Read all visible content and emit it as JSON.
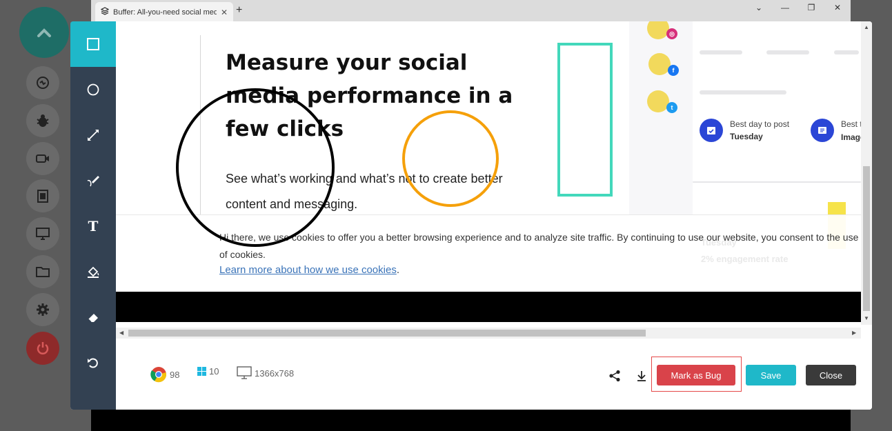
{
  "browser": {
    "tab_title": "Buffer: All-you-need social media",
    "tab_close": "✕",
    "new_tab": "+",
    "window_controls": [
      "⌄",
      "—",
      "❐",
      "✕"
    ]
  },
  "dock": {
    "items": [
      "back-up",
      "sync",
      "bug",
      "video",
      "clipboard",
      "screen",
      "folder",
      "settings",
      "power"
    ]
  },
  "toolbar": {
    "tools": [
      "rectangle",
      "circle",
      "arrow",
      "freehand",
      "text",
      "fill",
      "eraser",
      "undo"
    ],
    "text_tool_glyph": "T"
  },
  "page": {
    "headline": "Measure your social media performance in a few clicks",
    "subtext": "See what’s working and what’s not to create better content and messaging.",
    "stats": [
      {
        "label": "Best day to post",
        "value": "Tuesday"
      },
      {
        "label": "Best type of po",
        "value": "Image"
      }
    ],
    "ghost_day": "Tuesday",
    "ghost_rate": "2% engagement rate",
    "social_badges": [
      "instagram",
      "facebook",
      "twitter"
    ]
  },
  "cookie": {
    "text": "Hi there, we use cookies to offer you a better browsing experience and to analyze site traffic. By continuing to use our website, you consent to the use of cookies.",
    "link": "Learn more about how we use cookies",
    "link_suffix": "."
  },
  "footer": {
    "browser_version": "98",
    "os_version": "10",
    "resolution": "1366x768",
    "mark_bug_label": "Mark as Bug",
    "save_label": "Save",
    "close_label": "Close"
  },
  "colors": {
    "accent": "#1fb8c9",
    "toolbar": "#334152",
    "bug": "#d9434a",
    "close": "#3a3a3a",
    "annotation_black": "#000000",
    "annotation_orange": "#f5a00a",
    "annotation_teal": "#43d8bb"
  }
}
